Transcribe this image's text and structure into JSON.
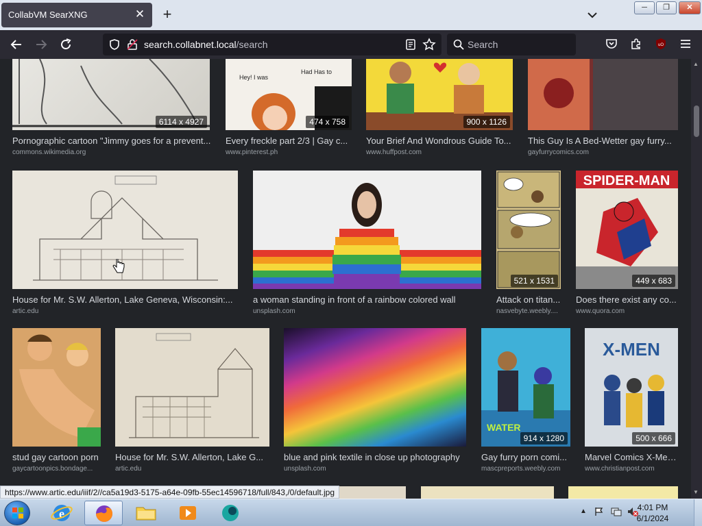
{
  "browser": {
    "tab_title": "CollabVM SearXNG",
    "tab_close": "✕",
    "new_tab": "+",
    "url_host": "search.collabnet.local",
    "url_path": "/search",
    "search_placeholder": "Search",
    "window_minimize": "─",
    "window_maximize": "❐",
    "window_close": "✕"
  },
  "results": {
    "row1": [
      {
        "title": "Pornographic cartoon \"Jimmy goes for a prevent...",
        "source": "commons.wikimedia.org",
        "resolution": "6114 x 4927"
      },
      {
        "title": "Every freckle part 2/3 | Gay c...",
        "source": "www.pinterest.ph",
        "resolution": "474 x 758"
      },
      {
        "title": "Your Brief And Wondrous Guide To...",
        "source": "www.huffpost.com",
        "resolution": "900 x 1126"
      },
      {
        "title": "This Guy Is A Bed-Wetter gay furry...",
        "source": "gayfurrycomics.com",
        "resolution": ""
      }
    ],
    "row2": [
      {
        "title": "House for Mr. S.W. Allerton, Lake Geneva, Wisconsin:...",
        "source": "artic.edu",
        "resolution": ""
      },
      {
        "title": "a woman standing in front of a rainbow colored wall",
        "source": "unsplash.com",
        "resolution": ""
      },
      {
        "title": "Attack on titan...",
        "source": "nasvebyte.weebly....",
        "resolution": "521 x 1531"
      },
      {
        "title": "Does there exist any co...",
        "source": "www.quora.com",
        "resolution": "449 x 683"
      }
    ],
    "row3": [
      {
        "title": "stud gay cartoon porn",
        "source": "gaycartoonpics.bondage...",
        "resolution": ""
      },
      {
        "title": "House for Mr. S.W. Allerton, Lake G...",
        "source": "artic.edu",
        "resolution": ""
      },
      {
        "title": "blue and pink textile in close up photography",
        "source": "unsplash.com",
        "resolution": ""
      },
      {
        "title": "Gay furry porn comi...",
        "source": "mascpreports.weebly.com",
        "resolution": "914 x 1280"
      },
      {
        "title": "Marvel Comics X-Men...",
        "source": "www.christianpost.com",
        "resolution": "500 x 666"
      }
    ]
  },
  "status_url": "https://www.artic.edu/iiif/2//ca5a19d3-5175-a64e-09fb-55ec14596718/full/843,/0/default.jpg",
  "taskbar": {
    "time": "4:01 PM",
    "date": "6/1/2024"
  },
  "colors": {
    "content_bg": "#222428",
    "toolbar_bg": "#2b2a33",
    "tab_active_bg": "#42414d"
  }
}
